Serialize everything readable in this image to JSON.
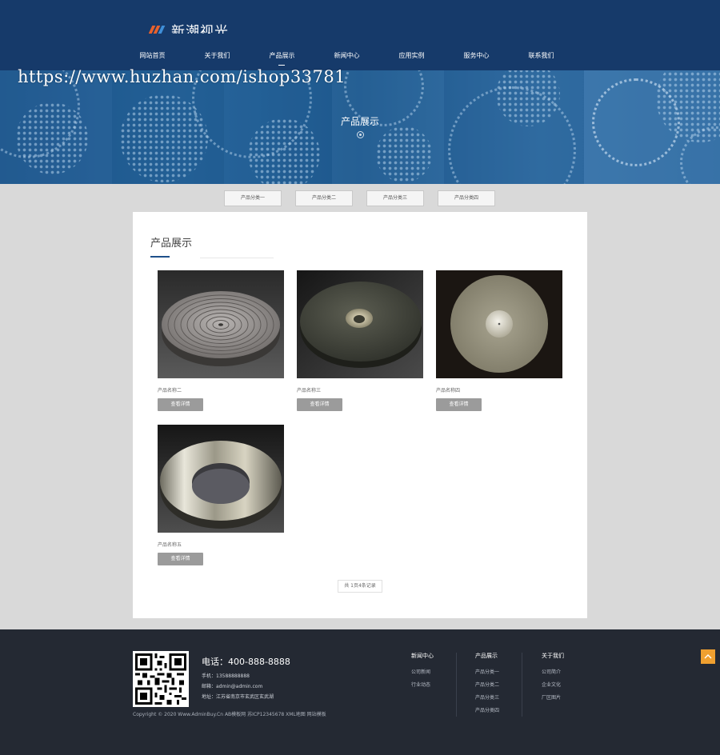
{
  "header": {
    "logo_text": "新潮视光",
    "nav": [
      "网站首页",
      "关于我们",
      "产品展示",
      "新闻中心",
      "应用实例",
      "服务中心",
      "联系我们"
    ],
    "active_nav": "产品展示"
  },
  "banner": {
    "title": "产品展示"
  },
  "watermark": "https://www.huzhan.com/ishop33781",
  "categories": [
    "产品分类一",
    "产品分类二",
    "产品分类三",
    "产品分类四"
  ],
  "content": {
    "title": "产品展示",
    "products": [
      {
        "name": "产品名称二",
        "button": "查看详情",
        "image": "spiral-grooved-disc"
      },
      {
        "name": "产品名称三",
        "button": "查看详情",
        "image": "dark-disc-with-hub"
      },
      {
        "name": "产品名称四",
        "button": "查看详情",
        "image": "silver-disc-on-black"
      },
      {
        "name": "产品名称五",
        "button": "查看详情",
        "image": "metal-ring-disc"
      }
    ],
    "pagination": "共 1页4条记录"
  },
  "footer": {
    "phone_label": "电话：400-888-8888",
    "mobile": "手机：13588888888",
    "email": "邮箱：admin@admin.com",
    "address": "地址：江苏省南京市玄武区玄武湖",
    "copyright": "Copyright © 2020 Www.AdminBuy.Cn AB模板网 苏ICP12345678 XML地图 网站模板",
    "columns": [
      {
        "title": "新闻中心",
        "items": [
          "公司新闻",
          "行业动态"
        ]
      },
      {
        "title": "产品展示",
        "items": [
          "产品分类一",
          "产品分类二",
          "产品分类三",
          "产品分类四"
        ]
      },
      {
        "title": "关于我们",
        "items": [
          "公司简介",
          "企业文化",
          "厂区图片"
        ]
      }
    ]
  },
  "colors": {
    "header_bg": "#163a6a",
    "footer_bg": "#242933",
    "accent": "#1e4f8a",
    "back_to_top": "#f0a030"
  },
  "icons": [
    "logo-mark-icon",
    "qr-code-icon",
    "arrow-up-icon"
  ]
}
